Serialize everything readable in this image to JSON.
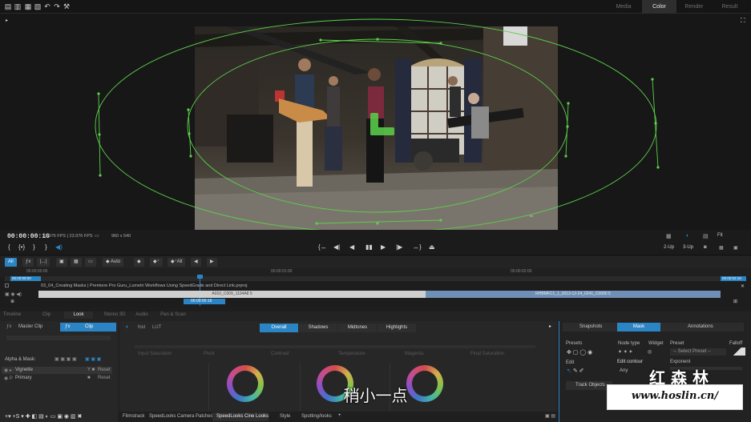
{
  "workspace_tabs": [
    "Media",
    "Color",
    "Render",
    "Result"
  ],
  "active_tab": "Color",
  "timecode": "00:00:00:16",
  "fps_info": "23.976 FPS | 23.976 FPS",
  "resolution": "960 x 540",
  "zoom": "Fit",
  "view_modes": [
    "2-Up",
    "3-Up"
  ],
  "timeline_tools": {
    "all": "All",
    "auto": "Auto",
    "all2": "All"
  },
  "ruler": [
    "00:00:00:00",
    "00:00:00:00",
    "00:00:01:00",
    "00:00:02:00",
    "00:00:02:18"
  ],
  "project_path": "03_04_Creating Masks | Premiere Pro Guru_Lumetri Workflows Using SpeedGrade and Direct Link.prproj",
  "clip1": "A010_C009_1104A8 5",
  "clip2": "RHBMFC1_1_2013-12-24_0241_C0000 5",
  "playhead_tc": "00:00:00:16",
  "panel_tabs": [
    "Timeline",
    "Clip",
    "Look",
    "Stereo 3D",
    "Audio",
    "Pan & Scan"
  ],
  "active_panel_tab": "Look",
  "master_clip": "Master Clip",
  "clip_label": "Clip",
  "alpha_mask": "Alpha & Mask:",
  "layers": [
    {
      "name": "Vignette",
      "reset": "Reset"
    },
    {
      "name": "Primary",
      "reset": "Reset"
    }
  ],
  "look_tabs": [
    "Overall",
    "Shadows",
    "Midtones",
    "Highlights"
  ],
  "active_look_tab": "Overall",
  "slider_labels": [
    "Input Saturation",
    "Pivot",
    "Contrast",
    "Temperature",
    "Magenta",
    "Final Saturation"
  ],
  "bottom_tabs": [
    "Filmstrack",
    "SpeedLooks Camera Patches",
    "SpeedLooks Cine Looks",
    "Style",
    "Spotting/looks"
  ],
  "active_bottom_tab": "SpeedLooks Cine Looks",
  "right_tabs": [
    "Snapshots",
    "Mask",
    "Annotations"
  ],
  "active_right_tab": "Mask",
  "presets": "Presets",
  "node_type": "Node type",
  "widget": "Widget",
  "preset": "Preset",
  "falloff": "Falloff",
  "select_preset": "-- Select Preset --",
  "edit": "Edit",
  "edit_contour": "Edit contour",
  "any": "Any",
  "exponent": "Exponent",
  "track_objects": "Track Objects",
  "subtitle": "稍小一点",
  "watermark_cn": "红 森 林",
  "watermark_url": "www.hoslin.cn/",
  "colors": {
    "accent": "#2b84c4",
    "mask": "#5bd14a"
  }
}
